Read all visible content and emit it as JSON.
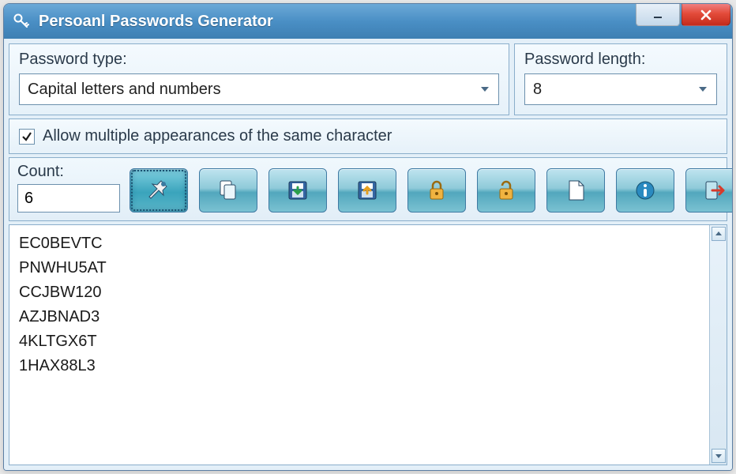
{
  "window": {
    "title": "Persoanl Passwords Generator"
  },
  "controls": {
    "type_label": "Password type:",
    "type_value": "Capital letters and numbers",
    "length_label": "Password length:",
    "length_value": "8",
    "allow_multiple": "Allow multiple appearances of the same character",
    "allow_multiple_checked": true,
    "count_label": "Count:",
    "count_value": "6"
  },
  "toolbar": [
    {
      "name": "generate",
      "icon": "pin",
      "active": true
    },
    {
      "name": "copy",
      "icon": "copy",
      "active": false
    },
    {
      "name": "save",
      "icon": "save-down",
      "active": false
    },
    {
      "name": "export",
      "icon": "save-up",
      "active": false
    },
    {
      "name": "lock",
      "icon": "lock",
      "active": false
    },
    {
      "name": "unlock",
      "icon": "unlock",
      "active": false
    },
    {
      "name": "new",
      "icon": "page",
      "active": false
    },
    {
      "name": "about",
      "icon": "info",
      "active": false
    },
    {
      "name": "exit",
      "icon": "exit",
      "active": false
    }
  ],
  "results": [
    "EC0BEVTC",
    "PNWHU5AT",
    "CCJBW120",
    "AZJBNAD3",
    "4KLTGX6T",
    "1HAX88L3"
  ]
}
